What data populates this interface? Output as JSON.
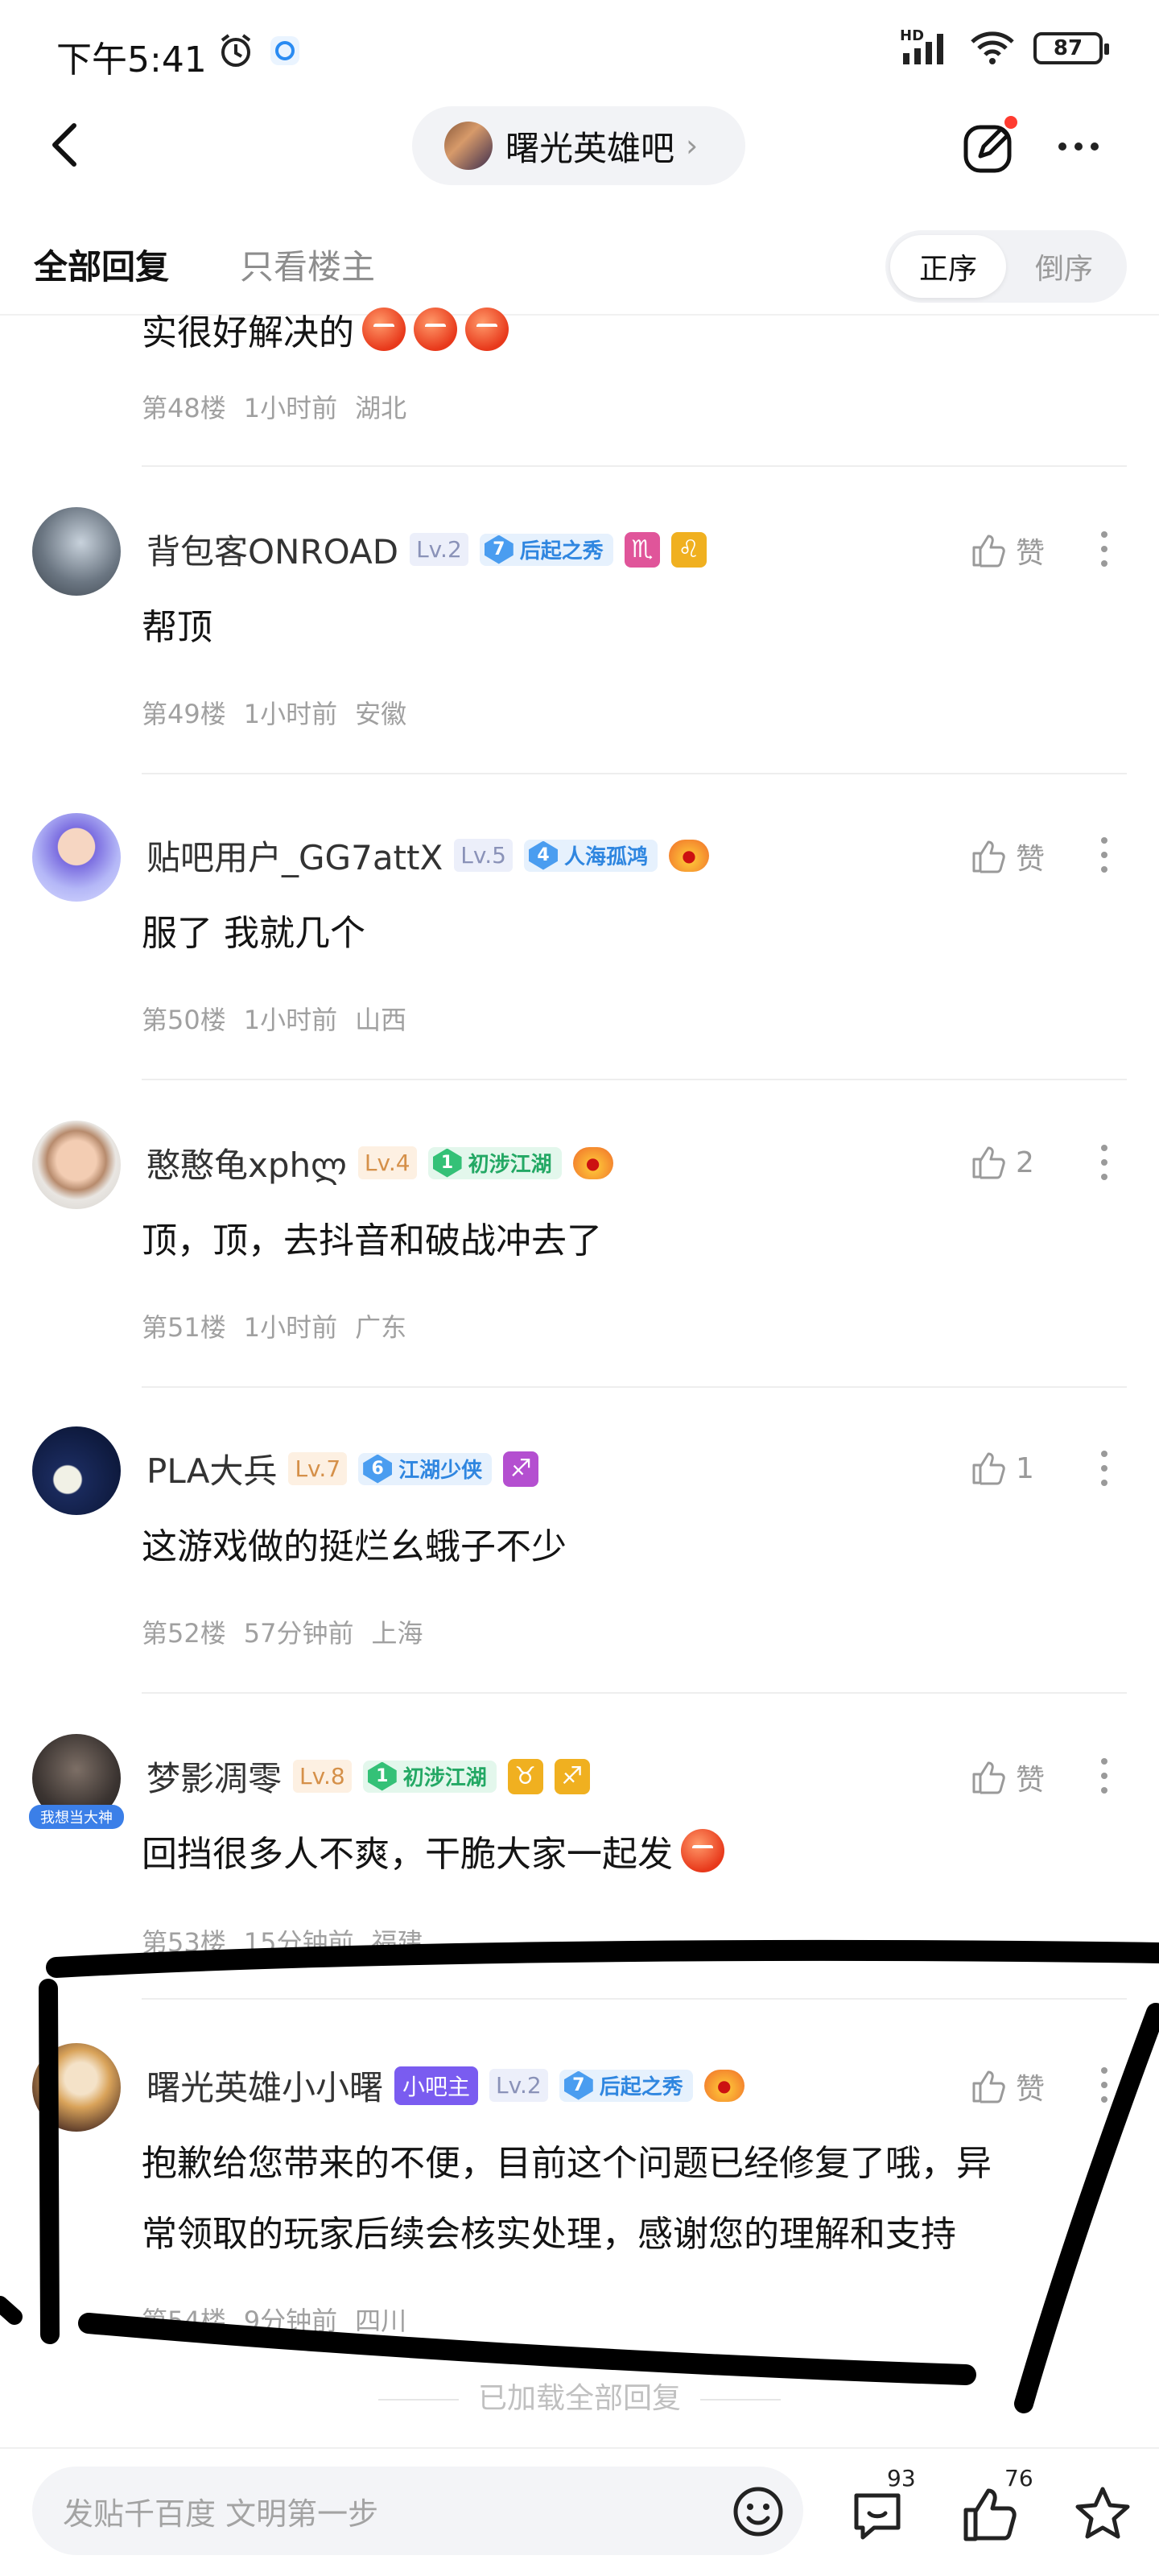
{
  "status_bar": {
    "time": "下午5:41",
    "network": "HD",
    "battery": "87"
  },
  "nav": {
    "forum_name": "曙光英雄吧"
  },
  "tabs": {
    "all_replies": "全部回复",
    "op_only": "只看楼主",
    "order_asc": "正序",
    "order_desc": "倒序"
  },
  "partial_post": {
    "content": "实很好解决的",
    "floor": "第48楼",
    "time": "1小时前",
    "location": "湖北"
  },
  "posts": [
    {
      "username": "背包客ONROAD",
      "level": "Lv.2",
      "honor_num": "7",
      "honor": "后起之秀",
      "zodiac": [
        "♏",
        "♌"
      ],
      "like": "赞",
      "content": "帮顶",
      "floor": "第49楼",
      "time": "1小时前",
      "location": "安徽"
    },
    {
      "username": "贴吧用户_GG7attX",
      "level": "Lv.5",
      "honor_num": "4",
      "honor": "人海孤鸿",
      "like": "赞",
      "content": "服了 我就几个",
      "floor": "第50楼",
      "time": "1小时前",
      "location": "山西"
    },
    {
      "username": "憨憨龟xphლ",
      "level": "Lv.4",
      "honor_num": "1",
      "honor": "初涉江湖",
      "like": "2",
      "content": "顶，顶，去抖音和破战冲去了",
      "floor": "第51楼",
      "time": "1小时前",
      "location": "广东"
    },
    {
      "username": "PLA大兵",
      "level": "Lv.7",
      "honor_num": "6",
      "honor": "江湖少侠",
      "zodiac": [
        "♐"
      ],
      "like": "1",
      "content": "这游戏做的挺烂幺蛾子不少",
      "floor": "第52楼",
      "time": "57分钟前",
      "location": "上海"
    },
    {
      "username": "梦影凋零",
      "level": "Lv.8",
      "honor_num": "1",
      "honor": "初涉江湖",
      "zodiac": [
        "♉",
        "♐"
      ],
      "avatar_badge": "我想当大神",
      "like": "赞",
      "content": "回挡很多人不爽，干脆大家一起发",
      "floor": "第53楼",
      "time": "15分钟前",
      "location": "福建"
    },
    {
      "username": "曙光英雄小小曙",
      "mod_badge": "小吧主",
      "level": "Lv.2",
      "honor_num": "7",
      "honor": "后起之秀",
      "like": "赞",
      "content_line1": "抱歉给您带来的不便，目前这个问题已经修复了哦，异",
      "content_line2": "常领取的玩家后续会核实处理，感谢您的理解和支持",
      "floor": "第54楼",
      "time": "9分钟前",
      "location": "四川"
    }
  ],
  "loaded_all": "已加载全部回复",
  "bottom": {
    "placeholder": "发贴千百度 文明第一步",
    "comment_count": "93",
    "like_count": "76"
  },
  "colors": {
    "mod_badge": "#7a5cf0",
    "honor_blue": "#2f86e0",
    "honor_green": "#23a864",
    "zodiac_pink": "#e0559a",
    "zodiac_yellow": "#f0b020",
    "zodiac_purple": "#b44fd0",
    "marker": "#000000"
  }
}
